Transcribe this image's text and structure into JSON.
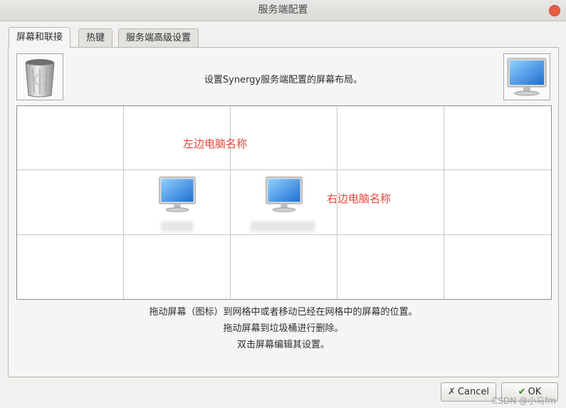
{
  "window": {
    "title": "服务端配置"
  },
  "tabs": [
    {
      "label": "屏幕和联接",
      "active": true
    },
    {
      "label": "热键",
      "active": false
    },
    {
      "label": "服务端高级设置",
      "active": false
    }
  ],
  "layout": {
    "heading": "设置Synergy服务端配置的屏幕布局。",
    "annotations": {
      "left": "左边电脑名称",
      "right": "右边电脑名称"
    },
    "help_lines": [
      "拖动屏幕（图标）到网格中或者移动已经在网格中的屏幕的位置。",
      "拖动屏幕到垃圾桶进行删除。",
      "双击屏幕编辑其设置。"
    ]
  },
  "buttons": {
    "cancel": {
      "label": "Cancel",
      "icon": "close-x-icon"
    },
    "ok": {
      "label": "OK",
      "icon": "checkmark-icon"
    }
  },
  "watermark": "CSDN @小马fm",
  "colors": {
    "annotation": "#e8463c",
    "close": "#e95d43",
    "accent": "#3c8ae0"
  }
}
